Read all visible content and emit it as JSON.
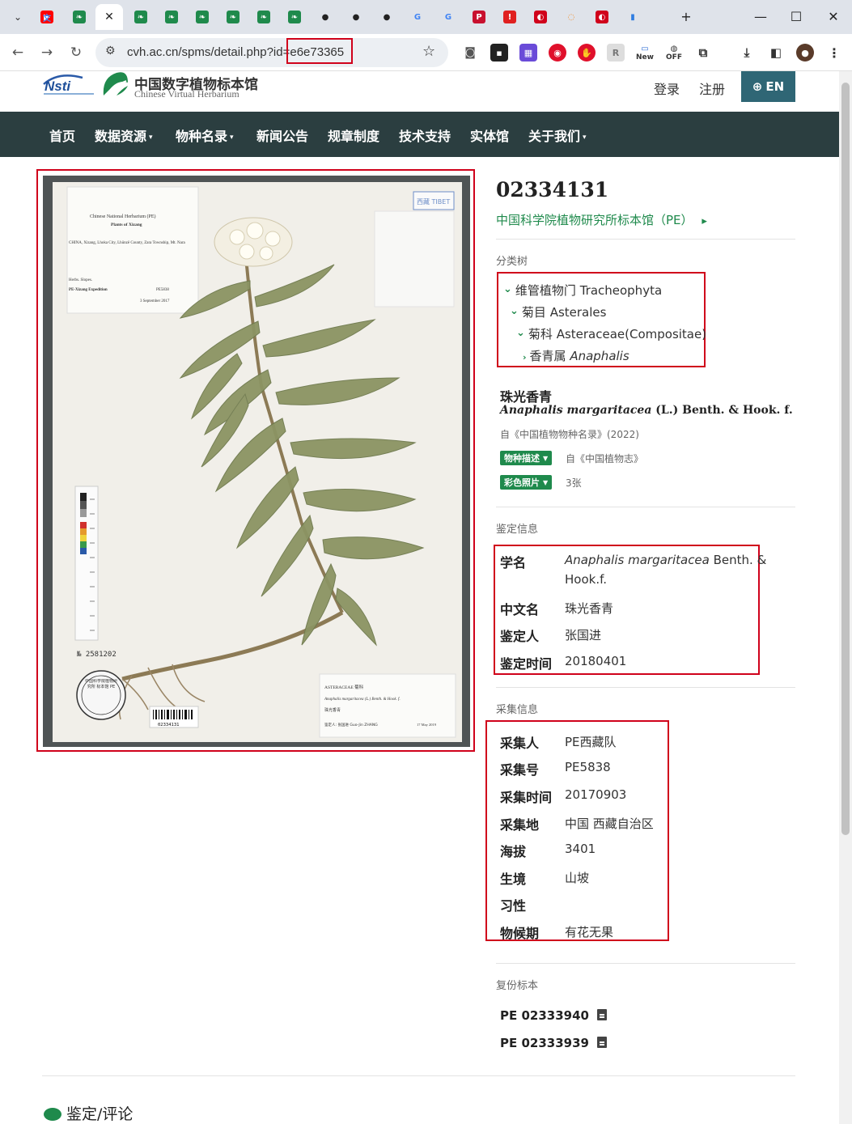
{
  "browser": {
    "tabs": [
      {
        "icon": "youtube-icon",
        "color": "#ff0000",
        "glyph": "▶"
      },
      {
        "icon": "cvh-leaf-icon",
        "color": "#1f8a4c",
        "glyph": "❧"
      },
      {
        "icon": "close-icon",
        "color": "#222222",
        "glyph": "✕",
        "active": true
      },
      {
        "icon": "cvh-leaf-icon",
        "color": "#1f8a4c",
        "glyph": "❧"
      },
      {
        "icon": "cvh-leaf-icon",
        "color": "#1f8a4c",
        "glyph": "❧"
      },
      {
        "icon": "cvh-leaf-icon",
        "color": "#1f8a4c",
        "glyph": "❧"
      },
      {
        "icon": "cvh-leaf-icon",
        "color": "#1f8a4c",
        "glyph": "❧"
      },
      {
        "icon": "cvh-leaf-icon",
        "color": "#1f8a4c",
        "glyph": "❧"
      },
      {
        "icon": "cvh-leaf-icon",
        "color": "#1f8a4c",
        "glyph": "❧"
      },
      {
        "icon": "github-icon",
        "color": "#222222",
        "glyph": "●"
      },
      {
        "icon": "github-icon",
        "color": "#222222",
        "glyph": "●"
      },
      {
        "icon": "github-icon",
        "color": "#222222",
        "glyph": "●"
      },
      {
        "icon": "google-icon",
        "color": "#4285f4",
        "glyph": "G"
      },
      {
        "icon": "google-icon",
        "color": "#4285f4",
        "glyph": "G"
      },
      {
        "icon": "pcgamer-icon",
        "color": "#c8102e",
        "glyph": "P"
      },
      {
        "icon": "alert-icon",
        "color": "#e02020",
        "glyph": "!"
      },
      {
        "icon": "red-circle-icon",
        "color": "#d0021b",
        "glyph": "◐"
      },
      {
        "icon": "orange-ring-icon",
        "color": "#f08a24",
        "glyph": "◌"
      },
      {
        "icon": "red-circle-icon",
        "color": "#d0021b",
        "glyph": "◐"
      },
      {
        "icon": "bar-chart-icon",
        "color": "#2f7de1",
        "glyph": "▮"
      },
      {
        "icon": "translate-icon",
        "color": "#4285f4",
        "glyph": "文"
      }
    ],
    "new_tab": "+",
    "window_controls": {
      "minimize": "—",
      "maximize": "☐",
      "close": "✕"
    },
    "url_prefix": "cvh.ac.cn/spms/detail.php?id",
    "url_id": "=e6e73365",
    "extensions_new_label": "New",
    "extensions_off_label": "OFF"
  },
  "site": {
    "logo_nsti": "Nsti",
    "logo_cn": "中国数字植物标本馆",
    "logo_en": "Chinese Virtual Herbarium",
    "login": "登录",
    "register": "注册",
    "lang": "EN",
    "nav": [
      {
        "label": "首页",
        "dropdown": false
      },
      {
        "label": "数据资源",
        "dropdown": true
      },
      {
        "label": "物种名录",
        "dropdown": true
      },
      {
        "label": "新闻公告",
        "dropdown": false
      },
      {
        "label": "规章制度",
        "dropdown": false
      },
      {
        "label": "技术支持",
        "dropdown": false
      },
      {
        "label": "实体馆",
        "dropdown": false
      },
      {
        "label": "关于我们",
        "dropdown": true
      }
    ],
    "dropdown_caret": "▾"
  },
  "specimen": {
    "catalog_number": "02334131",
    "institution": "中国科学院植物研究所标本馆（PE）",
    "institution_arrow": "▸",
    "sheet_labels": {
      "header": "Chinese National Herbarium (PE)",
      "subheader": "Plants of Xizang",
      "locality": "CHINA, Xizang, Lhoka City, Lhünzê County, Zara Township, Mt. Nara",
      "habit": "Herbs. Slopes.",
      "expedition": "PE-Xizang Expedition",
      "collection_no": "PE5838",
      "date": "3 September 2017",
      "tibet_stamp": "西藏 TIBET",
      "barcode_no": "02334131",
      "number_stamp": "№ 2581202",
      "det_family": "ASTERACEAE 菊科",
      "det_name": "Anaphalis margaritacea (L.) Benth. & Hook. f.",
      "det_cn": "珠光香青",
      "det_by": "鉴定人: 张国进 Guo-Jin ZHANG",
      "det_date": "17 May 2019",
      "seal_text": "中国科学院植物研究所 标本馆 PE"
    }
  },
  "taxonomy": {
    "label": "分类树",
    "chevron_open": "⌄",
    "chevron_closed": "›",
    "levels": [
      {
        "cn": "维管植物门",
        "latin": "Tracheophyta",
        "italic": false
      },
      {
        "cn": "菊目",
        "latin": "Asterales",
        "italic": false
      },
      {
        "cn": "菊科",
        "latin": "Asteraceae(Compositae)",
        "italic": false
      },
      {
        "cn": "香青属",
        "latin": "Anaphalis",
        "italic": true
      }
    ]
  },
  "species": {
    "cn_name": "珠光香青",
    "sci_name": "Anaphalis margaritacea",
    "author": "(L.) Benth. & Hook. f.",
    "source": "自《中国植物物种名录》(2022)",
    "desc_badge": "物种描述",
    "desc_note": "自《中国植物志》",
    "photo_badge": "彩色照片",
    "photo_note": "3张"
  },
  "identification": {
    "label": "鉴定信息",
    "rows": [
      {
        "key": "学名",
        "value_italic": "Anaphalis margaritacea",
        "value": "Benth. &",
        "value2": "Hook.f."
      },
      {
        "key": "中文名",
        "value": "珠光香青"
      },
      {
        "key": "鉴定人",
        "value": "张国进"
      },
      {
        "key": "鉴定时间",
        "value": "20180401"
      }
    ]
  },
  "collection": {
    "label": "采集信息",
    "rows": [
      {
        "key": "采集人",
        "value": "PE西藏队"
      },
      {
        "key": "采集号",
        "value": "PE5838"
      },
      {
        "key": "采集时间",
        "value": "20170903"
      },
      {
        "key": "采集地",
        "value": "中国 西藏自治区"
      },
      {
        "key": "海拔",
        "value": "3401"
      },
      {
        "key": "生境",
        "value": "山坡"
      },
      {
        "key": "习性",
        "value": ""
      },
      {
        "key": "物候期",
        "value": "有花无果"
      }
    ]
  },
  "duplicates": {
    "label": "复份标本",
    "items": [
      "PE 02333940",
      "PE 02333939"
    ]
  },
  "comments": {
    "title": "鉴定/评论"
  },
  "colors": {
    "accent_green": "#1f8a4c",
    "nav_bg": "#2b3e40",
    "lang_btn": "#2f6675",
    "highlight_red": "#d0021b"
  }
}
